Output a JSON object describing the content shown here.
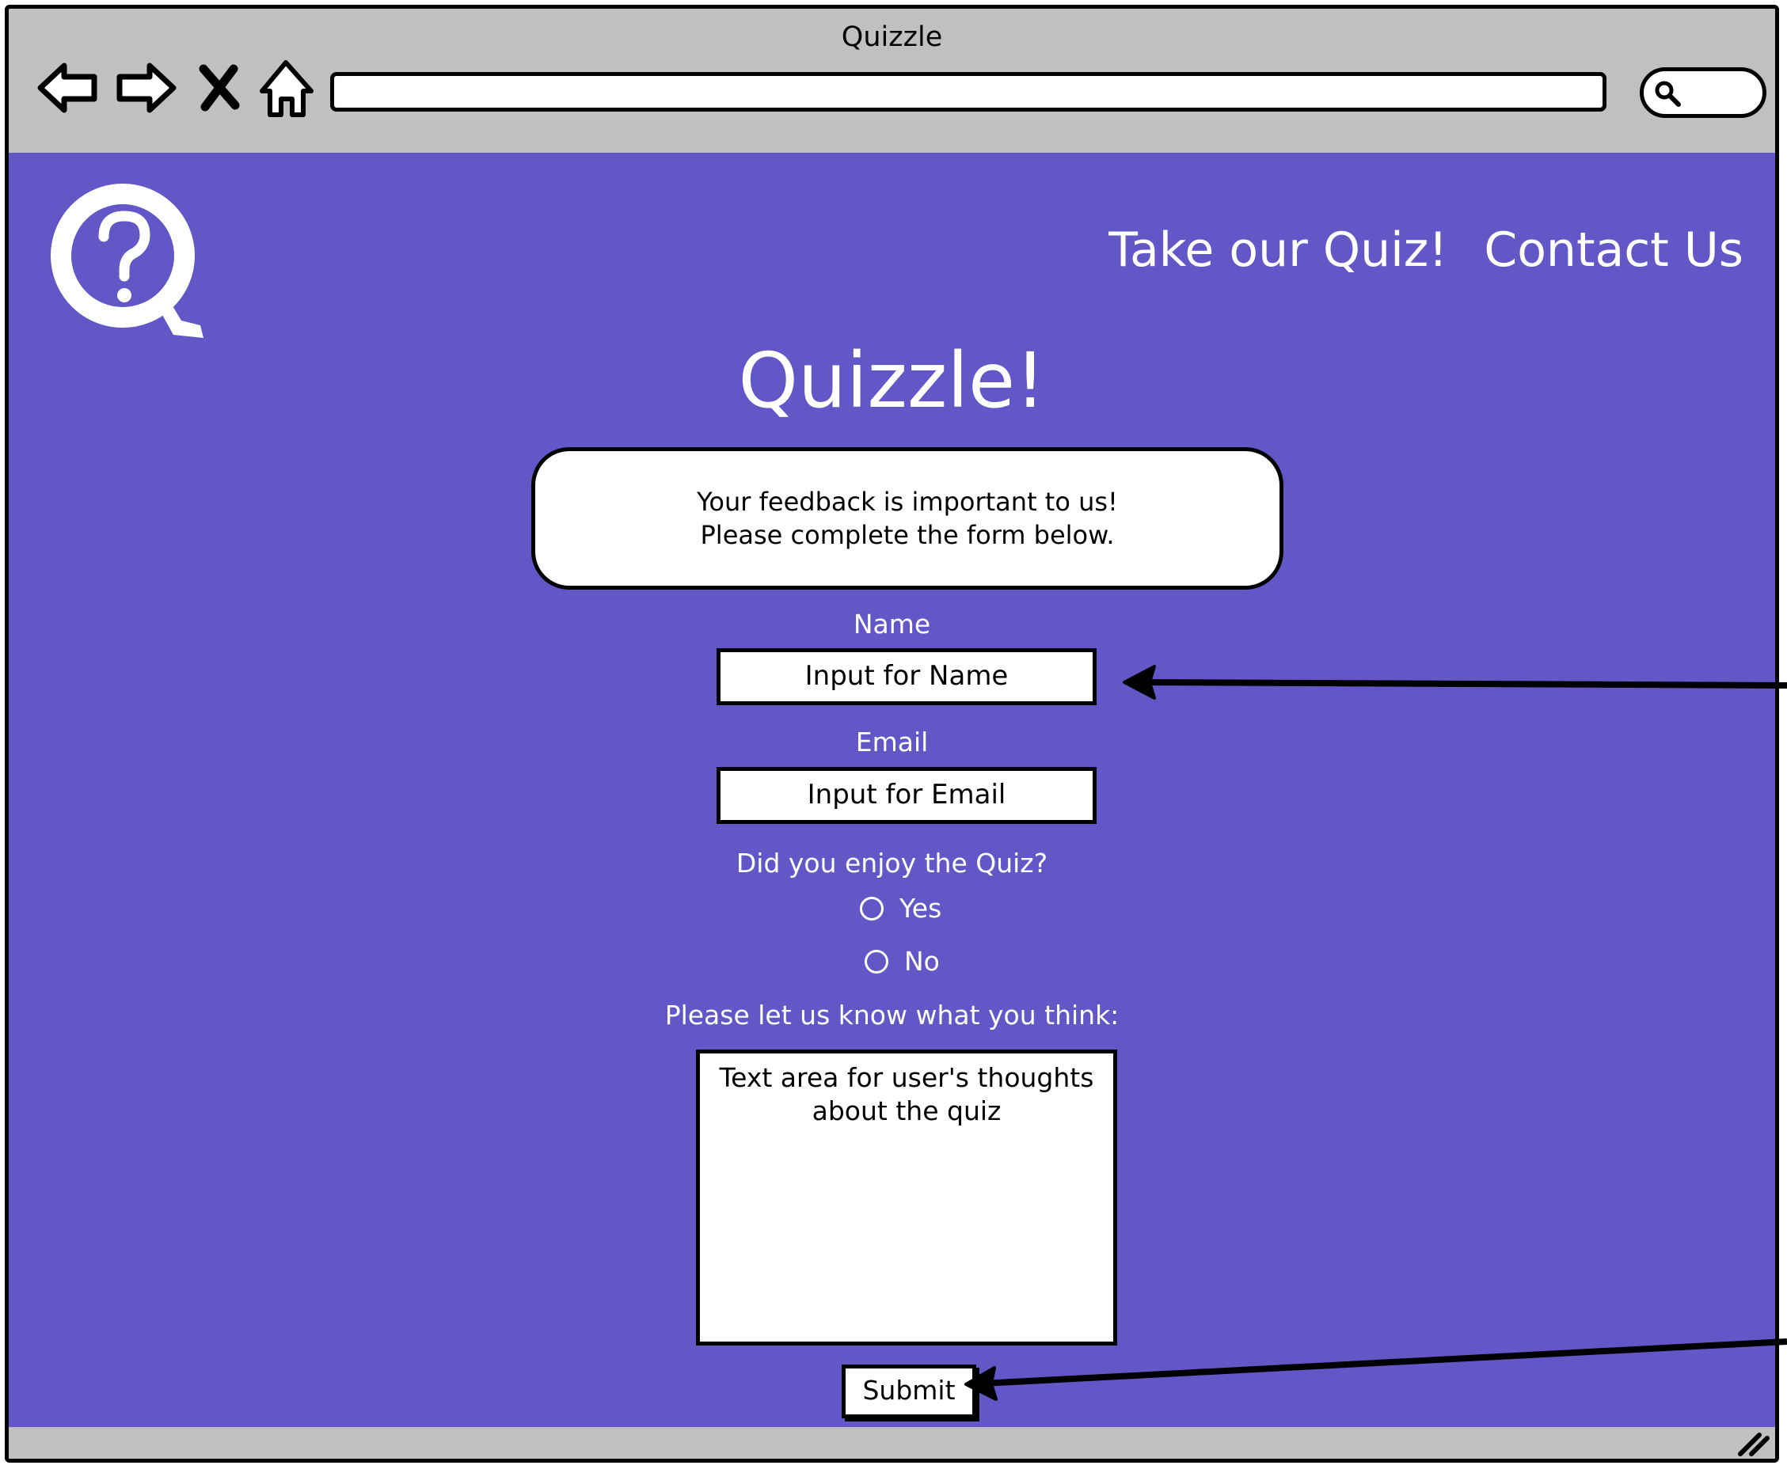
{
  "browser": {
    "title": "Quizzle",
    "address": "",
    "search": ""
  },
  "header": {
    "logo_icon": "question-q-logo-icon",
    "nav_links": [
      {
        "label": "Take our Quiz!"
      },
      {
        "label": "Contact Us"
      }
    ]
  },
  "page": {
    "title": "Quizzle!",
    "message_line1": "Your feedback is important to us!",
    "message_line2": "Please complete the form below."
  },
  "form": {
    "name_label": "Name",
    "name_placeholder": "Input for Name",
    "email_label": "Email",
    "email_placeholder": "Input for Email",
    "enjoy_question": "Did you enjoy the Quiz?",
    "radio_options": [
      {
        "label": "Yes",
        "selected": false
      },
      {
        "label": "No",
        "selected": false
      }
    ],
    "thoughts_label": "Please let us know what you think:",
    "thoughts_placeholder": "Text area for user's thoughts\nabout the quiz",
    "submit_label": "Submit"
  },
  "colors": {
    "page_background": "#6357c8",
    "chrome": "#c0c0c0",
    "text_light": "#ffffff"
  }
}
